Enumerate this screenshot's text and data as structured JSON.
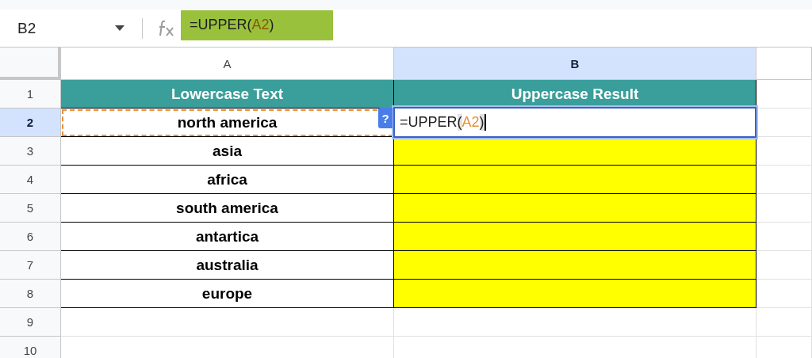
{
  "name_box": {
    "value": "B2"
  },
  "formula_bar": {
    "parts": [
      {
        "text": "=UPPER(",
        "kind": "plain"
      },
      {
        "text": "A2",
        "kind": "reference"
      },
      {
        "text": ")",
        "kind": "plain"
      }
    ]
  },
  "columns": [
    {
      "label": "A",
      "selected": false
    },
    {
      "label": "B",
      "selected": true
    }
  ],
  "rows": [
    {
      "number": "1",
      "selected": false,
      "cells": [
        {
          "kind": "header",
          "text": "Lowercase Text"
        },
        {
          "kind": "header",
          "text": "Uppercase Result"
        }
      ]
    },
    {
      "number": "2",
      "selected": true,
      "cells": [
        {
          "kind": "referenced",
          "text": "north america"
        },
        {
          "kind": "editing",
          "badge": "?",
          "parts": [
            {
              "text": "=UPPER",
              "kind": "plain"
            },
            {
              "text": "(",
              "kind": "paren"
            },
            {
              "text": "A2",
              "kind": "reference"
            },
            {
              "text": ")",
              "kind": "paren"
            }
          ]
        }
      ]
    },
    {
      "number": "3",
      "selected": false,
      "cells": [
        {
          "kind": "value",
          "text": "asia"
        },
        {
          "kind": "fill"
        }
      ]
    },
    {
      "number": "4",
      "selected": false,
      "cells": [
        {
          "kind": "value",
          "text": "africa"
        },
        {
          "kind": "fill"
        }
      ]
    },
    {
      "number": "5",
      "selected": false,
      "cells": [
        {
          "kind": "value",
          "text": "south america"
        },
        {
          "kind": "fill"
        }
      ]
    },
    {
      "number": "6",
      "selected": false,
      "cells": [
        {
          "kind": "value",
          "text": "antartica"
        },
        {
          "kind": "fill"
        }
      ]
    },
    {
      "number": "7",
      "selected": false,
      "cells": [
        {
          "kind": "value",
          "text": "australia"
        },
        {
          "kind": "fill"
        }
      ]
    },
    {
      "number": "8",
      "selected": false,
      "cells": [
        {
          "kind": "value",
          "text": "europe"
        },
        {
          "kind": "fill"
        }
      ]
    },
    {
      "number": "9",
      "selected": false,
      "cells": [
        {
          "kind": "empty"
        },
        {
          "kind": "empty"
        }
      ]
    },
    {
      "number": "10",
      "selected": false,
      "cells": [
        {
          "kind": "empty"
        },
        {
          "kind": "empty"
        }
      ]
    }
  ]
}
